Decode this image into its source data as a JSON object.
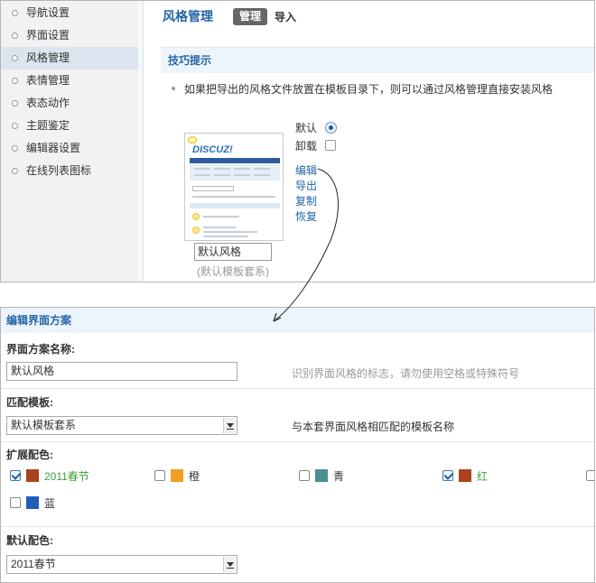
{
  "sidebar": {
    "items": [
      {
        "label": "导航设置",
        "active": false
      },
      {
        "label": "界面设置",
        "active": false
      },
      {
        "label": "风格管理",
        "active": true
      },
      {
        "label": "表情管理",
        "active": false
      },
      {
        "label": "表态动作",
        "active": false
      },
      {
        "label": "主题鉴定",
        "active": false
      },
      {
        "label": "编辑器设置",
        "active": false
      },
      {
        "label": "在线列表图标",
        "active": false
      }
    ]
  },
  "header": {
    "title": "风格管理",
    "tabs": [
      {
        "label": "管理",
        "active": true
      },
      {
        "label": "导入",
        "active": false
      }
    ]
  },
  "tips": {
    "title": "技巧提示",
    "text": "如果把导出的风格文件放置在模板目录下，则可以通过风格管理直接安装风格"
  },
  "style_item": {
    "thumbnail_logo": "DISCUZ!",
    "name": "默认风格",
    "template_set": "(默认模板套系)",
    "default_label": "默认",
    "default_selected": true,
    "uninstall_label": "卸载",
    "uninstall_checked": false,
    "actions": [
      "编辑",
      "导出",
      "复制",
      "恢复"
    ]
  },
  "edit_panel": {
    "header": "编辑界面方案",
    "name_label": "界面方案名称:",
    "name_value": "默认风格",
    "name_hint": "识别界面风格的标志，请勿使用空格或特殊符号",
    "template_label": "匹配模板:",
    "template_value": "默认模板套系",
    "template_desc": "与本套界面风格相匹配的模板名称",
    "colors_label": "扩展配色:",
    "colors": [
      {
        "name": "2011春节",
        "swatch": "#a9421d",
        "checked": true,
        "highlight": "#3aa33a"
      },
      {
        "name": "橙",
        "swatch": "#f0a020",
        "checked": false
      },
      {
        "name": "青",
        "swatch": "#4a8f8f",
        "checked": false
      },
      {
        "name": "红",
        "swatch": "#a9421d",
        "checked": true,
        "highlight": "#3aa33a"
      },
      {
        "name": "蓝",
        "swatch": "#1f5fb8",
        "checked": false
      }
    ],
    "default_color_label": "默认配色:",
    "default_color_value": "2011春节"
  }
}
